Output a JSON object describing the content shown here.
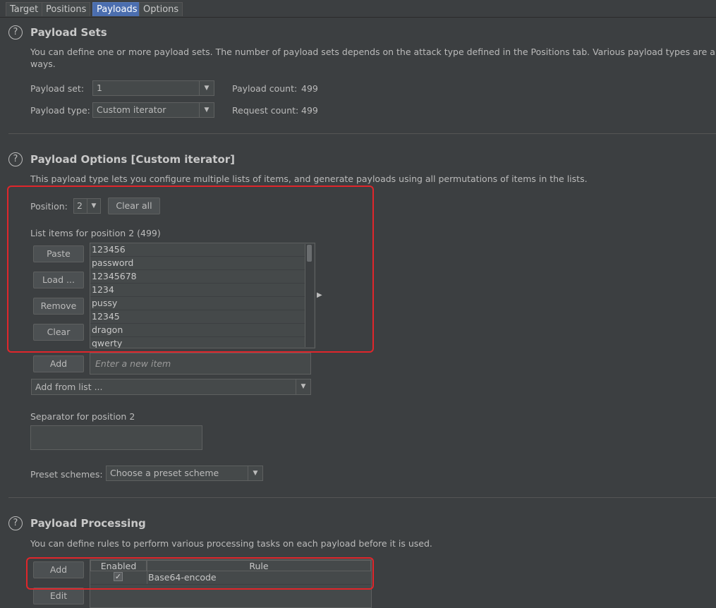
{
  "tabs": [
    "Target",
    "Positions",
    "Payloads",
    "Options"
  ],
  "payload_sets": {
    "title": "Payload Sets",
    "description_line1": "You can define one or more payload sets. The number of payload sets depends on the attack type defined in the Positions tab. Various payload types are a",
    "description_line2": "ways.",
    "set_label": "Payload set:",
    "set_value": "1",
    "type_label": "Payload type:",
    "type_value": "Custom iterator",
    "payload_count_label": "Payload count:",
    "payload_count": "499",
    "request_count_label": "Request count:",
    "request_count": "499"
  },
  "payload_options": {
    "title": "Payload Options [Custom iterator]",
    "description": "This payload type lets you configure multiple lists of items, and generate payloads using all permutations of items in the lists.",
    "position_label": "Position:",
    "position_value": "2",
    "clear_all": "Clear all",
    "list_label": "List items for position 2 (499)",
    "buttons": {
      "paste": "Paste",
      "load": "Load ...",
      "remove": "Remove",
      "clear": "Clear",
      "add": "Add"
    },
    "items": [
      "123456",
      "password",
      "12345678",
      "1234",
      "pussy",
      "12345",
      "dragon",
      "qwerty"
    ],
    "new_item_placeholder": "Enter a new item",
    "add_from_list": "Add from list ...",
    "separator_label": "Separator for position 2",
    "preset_label": "Preset schemes:",
    "preset_value": "Choose a preset scheme"
  },
  "payload_processing": {
    "title": "Payload Processing",
    "description": "You can define rules to perform various processing tasks on each payload before it is used.",
    "add": "Add",
    "edit": "Edit",
    "col_enabled": "Enabled",
    "col_rule": "Rule",
    "rule": "Base64-encode",
    "rule_enabled": true
  }
}
